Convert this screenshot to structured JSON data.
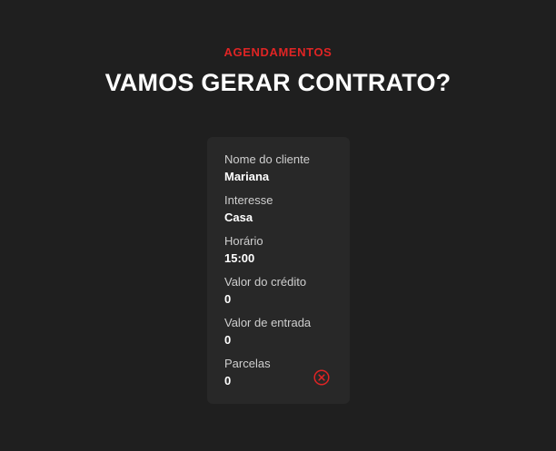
{
  "header": {
    "eyebrow": "AGENDAMENTOS",
    "title": "VAMOS GERAR CONTRATO?"
  },
  "card": {
    "fields": [
      {
        "label": "Nome do cliente",
        "value": "Mariana"
      },
      {
        "label": "Interesse",
        "value": "Casa"
      },
      {
        "label": "Horário",
        "value": "15:00"
      },
      {
        "label": "Valor do crédito",
        "value": "0"
      },
      {
        "label": "Valor de entrada",
        "value": "0"
      },
      {
        "label": "Parcelas",
        "value": "0"
      }
    ],
    "close_icon": "close-circle-icon"
  },
  "colors": {
    "background": "#1f1f1f",
    "card": "#282828",
    "accent": "#e02424",
    "text": "#ffffff",
    "muted": "#cfcfcf"
  }
}
